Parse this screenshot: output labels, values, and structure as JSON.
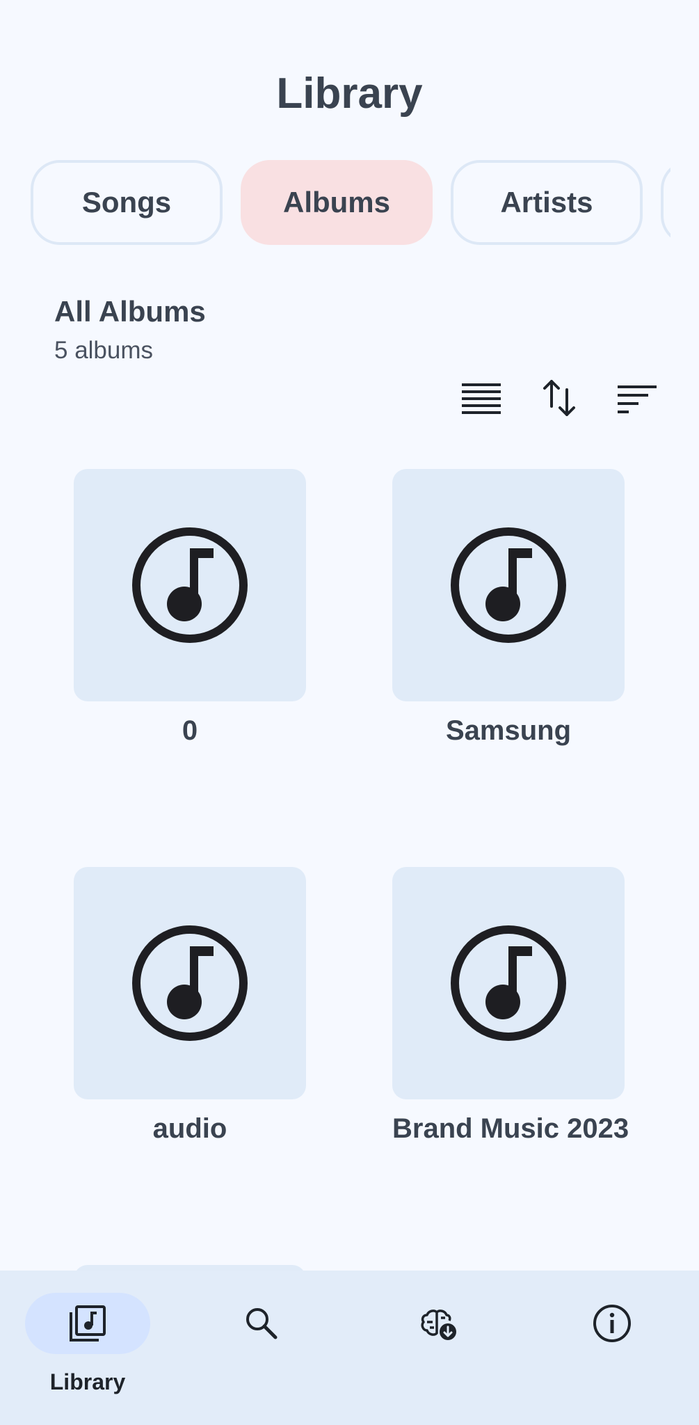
{
  "header": {
    "title": "Library"
  },
  "tabs": [
    {
      "label": "Songs",
      "active": false
    },
    {
      "label": "Albums",
      "active": true
    },
    {
      "label": "Artists",
      "active": false
    }
  ],
  "section": {
    "title": "All Albums",
    "count": "5 albums"
  },
  "toolbar": {
    "view_icon": "list-view-icon",
    "sort_icon": "sort-order-icon",
    "filter_icon": "filter-icon"
  },
  "albums": [
    {
      "name": "0",
      "icon": "music-note-icon"
    },
    {
      "name": "Samsung",
      "icon": "music-note-icon"
    },
    {
      "name": "audio",
      "icon": "music-note-icon"
    },
    {
      "name": "Brand Music 2023",
      "icon": "music-note-icon"
    }
  ],
  "nav": {
    "items": [
      {
        "label": "Library",
        "icon": "library-icon",
        "active": true
      },
      {
        "label": "",
        "icon": "search-icon",
        "active": false
      },
      {
        "label": "",
        "icon": "ai-brain-download-icon",
        "active": false
      },
      {
        "label": "",
        "icon": "info-icon",
        "active": false
      }
    ]
  },
  "colors": {
    "background": "#f6f9ff",
    "active_tab": "#f9e0e2",
    "album_tile": "#e0ebf8",
    "nav_bar": "#e2ecf9",
    "nav_active_pill": "#d4e3ff"
  }
}
